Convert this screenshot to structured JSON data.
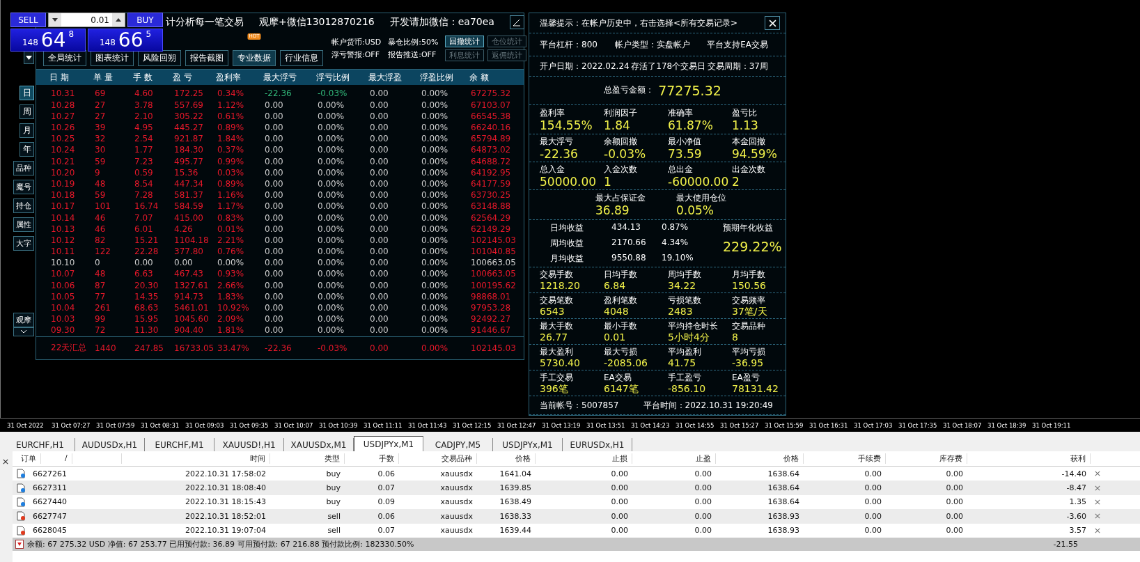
{
  "order_widget": {
    "sell_label": "SELL",
    "buy_label": "BUY",
    "volume": "0.01",
    "bid": {
      "prefix": "148",
      "main": "64",
      "sup": "8"
    },
    "ask": {
      "prefix": "148",
      "main": "66",
      "sup": "5"
    }
  },
  "stats_panel": {
    "title_parts": [
      "计分析每一笔交易",
      "观摩+微信13012870216",
      "开发请加微信：ea70ea"
    ],
    "toolbar_buttons": [
      {
        "label": "全局统计",
        "selected": false
      },
      {
        "label": "图表统计",
        "selected": false
      },
      {
        "label": "风险回朔",
        "selected": false
      },
      {
        "label": "报告截图",
        "selected": false
      },
      {
        "label": "专业数据",
        "selected": true,
        "badge": "HOT"
      },
      {
        "label": "行业信息",
        "selected": false
      }
    ],
    "info": [
      "帐户货币:USD",
      "暴仓比例:50%",
      "浮亏警报:OFF",
      "报告推送:OFF"
    ],
    "stat_buttons": [
      {
        "label": "回撤统计",
        "selected": true,
        "disabled": false
      },
      {
        "label": "仓位统计",
        "selected": false,
        "disabled": true
      },
      {
        "label": "利息统计",
        "selected": false,
        "disabled": true
      },
      {
        "label": "返佣统计",
        "selected": false,
        "disabled": true
      }
    ],
    "period_tabs": [
      {
        "label": "日",
        "selected": true
      },
      {
        "label": "周",
        "selected": false
      },
      {
        "label": "月",
        "selected": false
      },
      {
        "label": "年",
        "selected": false
      }
    ],
    "filter_buttons": [
      "品种",
      "魔号",
      "持仓",
      "属性",
      "大字"
    ],
    "watch_button": "观摩",
    "table": {
      "columns": [
        "日 期",
        "单 量",
        "手 数",
        "盈 亏",
        "盈利率",
        "最大浮亏",
        "浮亏比例",
        "最大浮盈",
        "浮盈比例",
        "余 额"
      ],
      "rows": [
        {
          "kind": "gain",
          "float_loss": true,
          "cells": [
            "10.31",
            "69",
            "4.60",
            "172.25",
            "0.34%",
            "-22.36",
            "-0.03%",
            "0.00",
            "0.00%",
            "67275.32"
          ]
        },
        {
          "kind": "gain",
          "float_loss": false,
          "cells": [
            "10.28",
            "27",
            "3.78",
            "557.69",
            "1.12%",
            "0.00",
            "0.00%",
            "0.00",
            "0.00%",
            "67103.07"
          ]
        },
        {
          "kind": "gain",
          "float_loss": false,
          "cells": [
            "10.27",
            "27",
            "2.10",
            "305.22",
            "0.61%",
            "0.00",
            "0.00%",
            "0.00",
            "0.00%",
            "66545.38"
          ]
        },
        {
          "kind": "gain",
          "float_loss": false,
          "cells": [
            "10.26",
            "39",
            "4.95",
            "445.27",
            "0.89%",
            "0.00",
            "0.00%",
            "0.00",
            "0.00%",
            "66240.16"
          ]
        },
        {
          "kind": "gain",
          "float_loss": false,
          "cells": [
            "10.25",
            "32",
            "2.54",
            "921.87",
            "1.84%",
            "0.00",
            "0.00%",
            "0.00",
            "0.00%",
            "65794.89"
          ]
        },
        {
          "kind": "gain",
          "float_loss": false,
          "cells": [
            "10.24",
            "30",
            "1.77",
            "184.30",
            "0.37%",
            "0.00",
            "0.00%",
            "0.00",
            "0.00%",
            "64873.02"
          ]
        },
        {
          "kind": "gain",
          "float_loss": false,
          "cells": [
            "10.21",
            "59",
            "7.23",
            "495.77",
            "0.99%",
            "0.00",
            "0.00%",
            "0.00",
            "0.00%",
            "64688.72"
          ]
        },
        {
          "kind": "gain",
          "float_loss": false,
          "cells": [
            "10.20",
            "9",
            "0.59",
            "15.36",
            "0.03%",
            "0.00",
            "0.00%",
            "0.00",
            "0.00%",
            "64192.95"
          ]
        },
        {
          "kind": "gain",
          "float_loss": false,
          "cells": [
            "10.19",
            "48",
            "8.54",
            "447.34",
            "0.89%",
            "0.00",
            "0.00%",
            "0.00",
            "0.00%",
            "64177.59"
          ]
        },
        {
          "kind": "gain",
          "float_loss": false,
          "cells": [
            "10.18",
            "59",
            "7.28",
            "581.37",
            "1.16%",
            "0.00",
            "0.00%",
            "0.00",
            "0.00%",
            "63730.25"
          ]
        },
        {
          "kind": "gain",
          "float_loss": false,
          "cells": [
            "10.17",
            "101",
            "16.74",
            "584.59",
            "1.17%",
            "0.00",
            "0.00%",
            "0.00",
            "0.00%",
            "63148.88"
          ]
        },
        {
          "kind": "gain",
          "float_loss": false,
          "cells": [
            "10.14",
            "46",
            "7.07",
            "415.00",
            "0.83%",
            "0.00",
            "0.00%",
            "0.00",
            "0.00%",
            "62564.29"
          ]
        },
        {
          "kind": "gain",
          "float_loss": false,
          "cells": [
            "10.13",
            "46",
            "6.01",
            "4.26",
            "0.01%",
            "0.00",
            "0.00%",
            "0.00",
            "0.00%",
            "62149.29"
          ]
        },
        {
          "kind": "gain",
          "float_loss": false,
          "cells": [
            "10.12",
            "82",
            "15.21",
            "1104.18",
            "2.21%",
            "0.00",
            "0.00%",
            "0.00",
            "0.00%",
            "102145.03"
          ]
        },
        {
          "kind": "gain",
          "float_loss": false,
          "cells": [
            "10.11",
            "122",
            "22.28",
            "377.80",
            "0.76%",
            "0.00",
            "0.00%",
            "0.00",
            "0.00%",
            "101040.85"
          ]
        },
        {
          "kind": "flat",
          "float_loss": false,
          "cells": [
            "10.10",
            "0",
            "0.00",
            "0.00",
            "0.00%",
            "0.00",
            "0.00%",
            "0.00",
            "0.00%",
            "100663.05"
          ]
        },
        {
          "kind": "gain",
          "float_loss": false,
          "cells": [
            "10.07",
            "48",
            "6.63",
            "467.43",
            "0.93%",
            "0.00",
            "0.00%",
            "0.00",
            "0.00%",
            "100663.05"
          ]
        },
        {
          "kind": "gain",
          "float_loss": false,
          "cells": [
            "10.06",
            "87",
            "20.30",
            "1327.61",
            "2.66%",
            "0.00",
            "0.00%",
            "0.00",
            "0.00%",
            "100195.62"
          ]
        },
        {
          "kind": "gain",
          "float_loss": false,
          "cells": [
            "10.05",
            "77",
            "14.35",
            "914.73",
            "1.83%",
            "0.00",
            "0.00%",
            "0.00",
            "0.00%",
            "98868.01"
          ]
        },
        {
          "kind": "gain",
          "float_loss": false,
          "cells": [
            "10.04",
            "261",
            "68.63",
            "5461.01",
            "10.92%",
            "0.00",
            "0.00%",
            "0.00",
            "0.00%",
            "97953.28"
          ]
        },
        {
          "kind": "gain",
          "float_loss": false,
          "cells": [
            "10.03",
            "99",
            "15.95",
            "1045.60",
            "2.09%",
            "0.00",
            "0.00%",
            "0.00",
            "0.00%",
            "92492.27"
          ]
        },
        {
          "kind": "gain",
          "float_loss": false,
          "cells": [
            "09.30",
            "72",
            "11.30",
            "904.40",
            "1.81%",
            "0.00",
            "0.00%",
            "0.00",
            "0.00%",
            "91446.67"
          ]
        }
      ],
      "summary": [
        "22天汇总",
        "1440",
        "247.85",
        "16733.05",
        "33.47%",
        "-22.36",
        "-0.03%",
        "0.00",
        "0.00%",
        "102145.03"
      ]
    }
  },
  "account_panel": {
    "notice": "温馨提示：在帐户历史中，右击选择<所有交易记录>",
    "info_rows": [
      [
        "平台杠杆：800",
        "帐户类型：实盘帐户",
        "平台支持EA交易"
      ],
      [
        "开户日期：2022.02.24",
        "存活了178个交易日",
        "交易周期：37周"
      ]
    ],
    "total": {
      "label": "总盈亏金额：",
      "value": "77275.32"
    },
    "key_metrics": [
      [
        {
          "label": "盈利率",
          "value": "154.55%"
        },
        {
          "label": "利润因子",
          "value": "1.84"
        },
        {
          "label": "准确率",
          "value": "61.87%"
        },
        {
          "label": "盈亏比",
          "value": "1.13"
        }
      ],
      [
        {
          "label": "最大浮亏",
          "value": "-22.36"
        },
        {
          "label": "余额回撤",
          "value": "-0.03%"
        },
        {
          "label": "最小净值",
          "value": "73.59"
        },
        {
          "label": "本金回撤",
          "value": "94.59%"
        }
      ],
      [
        {
          "label": "总入金",
          "value": "50000.00"
        },
        {
          "label": "入金次数",
          "value": "1"
        },
        {
          "label": "总出金",
          "value": "-60000.00"
        },
        {
          "label": "出金次数",
          "value": "2"
        }
      ]
    ],
    "margin_metrics": [
      {
        "label": "最大占保证金",
        "value": "36.89"
      },
      {
        "label": "最大使用仓位",
        "value": "0.05%"
      }
    ],
    "returns": {
      "rows": [
        {
          "label": "日均收益",
          "amount": "434.13",
          "percent": "0.87%"
        },
        {
          "label": "周均收益",
          "amount": "2170.66",
          "percent": "4.34%"
        },
        {
          "label": "月均收益",
          "amount": "9550.88",
          "percent": "19.10%"
        }
      ],
      "annual_label": "预期年化收益",
      "annual_value": "229.22%"
    },
    "trade_metrics": [
      [
        {
          "label": "交易手数",
          "value": "1218.20"
        },
        {
          "label": "日均手数",
          "value": "6.84"
        },
        {
          "label": "周均手数",
          "value": "34.22"
        },
        {
          "label": "月均手数",
          "value": "150.56"
        }
      ],
      [
        {
          "label": "交易笔数",
          "value": "6543"
        },
        {
          "label": "盈利笔数",
          "value": "4048"
        },
        {
          "label": "亏损笔数",
          "value": "2483"
        },
        {
          "label": "交易频率",
          "value": "37笔/天"
        }
      ],
      [
        {
          "label": "最大手数",
          "value": "26.77"
        },
        {
          "label": "最小手数",
          "value": "0.01"
        },
        {
          "label": "平均持仓时长",
          "value": "5小时4分"
        },
        {
          "label": "交易品种",
          "value": "8"
        }
      ],
      [
        {
          "label": "最大盈利",
          "value": "5730.40"
        },
        {
          "label": "最大亏损",
          "value": "-2085.06"
        },
        {
          "label": "平均盈利",
          "value": "41.75"
        },
        {
          "label": "平均亏损",
          "value": "-36.95"
        }
      ],
      [
        {
          "label": "手工交易",
          "value": "396笔"
        },
        {
          "label": "EA交易",
          "value": "6147笔"
        },
        {
          "label": "手工盈亏",
          "value": "-856.10"
        },
        {
          "label": "EA盈亏",
          "value": "78131.42"
        }
      ]
    ],
    "account": "当前帐号：5007857",
    "server_time": "平台时间：2022.10.31 19:20:49"
  },
  "time_axis": [
    "31 Oct 2022",
    "31 Oct 07:27",
    "31 Oct 07:59",
    "31 Oct 08:31",
    "31 Oct 09:03",
    "31 Oct 09:35",
    "31 Oct 10:07",
    "31 Oct 10:39",
    "31 Oct 11:11",
    "31 Oct 11:43",
    "31 Oct 12:15",
    "31 Oct 12:47",
    "31 Oct 13:19",
    "31 Oct 13:51",
    "31 Oct 14:23",
    "31 Oct 14:55",
    "31 Oct 15:27",
    "31 Oct 15:59",
    "31 Oct 16:31",
    "31 Oct 17:03",
    "31 Oct 17:35",
    "31 Oct 18:07",
    "31 Oct 18:39",
    "31 Oct 19:11"
  ],
  "chart_tabs": [
    {
      "label": "EURCHF,H1",
      "selected": false
    },
    {
      "label": "AUDUSDx,H1",
      "selected": false
    },
    {
      "label": "EURCHF,M1",
      "selected": false
    },
    {
      "label": "XAUUSD!,H1",
      "selected": false
    },
    {
      "label": "XAUUSDx,M1",
      "selected": false
    },
    {
      "label": "USDJPYx,M1",
      "selected": true
    },
    {
      "label": "CADJPY,M5",
      "selected": false
    },
    {
      "label": "USDJPYx,M1",
      "selected": false
    },
    {
      "label": "EURUSDx,H1",
      "selected": false
    }
  ],
  "orders": {
    "sort_mark": "/",
    "columns": [
      "订单",
      "时间",
      "类型",
      "手数",
      "交易品种",
      "价格",
      "止损",
      "止盈",
      "价格",
      "手续费",
      "库存费",
      "获利"
    ],
    "rows": [
      {
        "kind": "buy",
        "cells": [
          "6627261",
          "2022.10.31 17:58:02",
          "buy",
          "0.06",
          "xauusdx",
          "1641.04",
          "0.00",
          "0.00",
          "1638.64",
          "0.00",
          "0.00",
          "-14.40"
        ]
      },
      {
        "kind": "buy",
        "cells": [
          "6627311",
          "2022.10.31 18:08:40",
          "buy",
          "0.07",
          "xauusdx",
          "1639.85",
          "0.00",
          "0.00",
          "1638.64",
          "0.00",
          "0.00",
          "-8.47"
        ]
      },
      {
        "kind": "buy",
        "cells": [
          "6627440",
          "2022.10.31 18:15:43",
          "buy",
          "0.09",
          "xauusdx",
          "1638.49",
          "0.00",
          "0.00",
          "1638.64",
          "0.00",
          "0.00",
          "1.35"
        ]
      },
      {
        "kind": "sell",
        "cells": [
          "6627747",
          "2022.10.31 18:52:01",
          "sell",
          "0.06",
          "xauusdx",
          "1638.33",
          "0.00",
          "0.00",
          "1638.93",
          "0.00",
          "0.00",
          "-3.60"
        ]
      },
      {
        "kind": "sell",
        "cells": [
          "6628045",
          "2022.10.31 19:07:04",
          "sell",
          "0.07",
          "xauusdx",
          "1639.44",
          "0.00",
          "0.00",
          "1638.93",
          "0.00",
          "0.00",
          "3.57"
        ]
      }
    ],
    "summary": {
      "text": "余额: 67 275.32 USD  净值: 67 253.77  已用预付款: 36.89  可用预付款: 67 216.88  预付款比例: 182330.50%",
      "profit": "-21.55"
    }
  }
}
